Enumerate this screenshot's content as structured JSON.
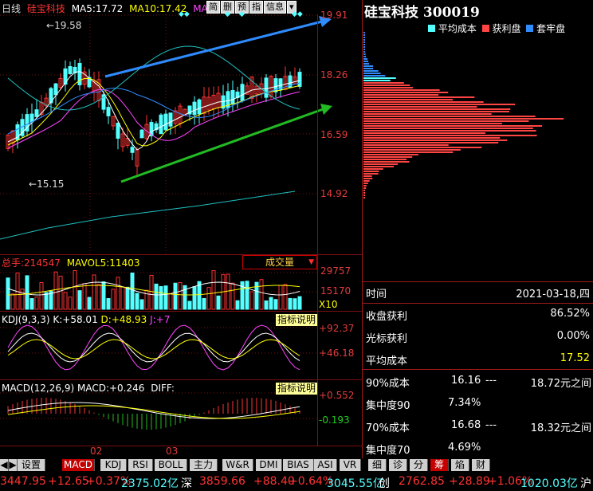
{
  "header": {
    "period": "日线",
    "stock_name": "硅宝科技",
    "ma5_label": "MA5:",
    "ma5_value": "17.72",
    "ma10_label": "MA10:",
    "ma10_value": "17.42",
    "ma20_label": "MA20:",
    "toolbar": [
      "简",
      "删",
      "预",
      "指",
      "信息"
    ],
    "dropdown_glyph": "▾"
  },
  "price_axis": {
    "labels": [
      "19.91",
      "18.26",
      "16.59",
      "14.92"
    ]
  },
  "price_annotations": {
    "high": "19.58",
    "low": "15.15"
  },
  "colors": {
    "background": "#000000",
    "up": "#ff3333",
    "down": "#54ffff",
    "grid": "#7a1010",
    "ma5": "#ffffff",
    "ma10": "#ffff00",
    "ma20": "#ff44ff",
    "channel_upper": "#2f8cff",
    "channel_lower": "#22bb22",
    "profit": "#ff4444",
    "locked": "#2f8cff",
    "avg_cost": "#54ffff"
  },
  "volume": {
    "label": "总手:",
    "value": "214547",
    "mavol_label": "MAVOL5:",
    "mavol_value": "11403",
    "dropdown": "成交量",
    "axis": [
      "29757",
      "15170",
      "X10"
    ]
  },
  "kdj": {
    "title": "KDJ(9,3,3)",
    "k_label": "K:",
    "k_value": "+58.01",
    "d_label": "D:",
    "d_value": "+48.93",
    "j_label": "J:",
    "j_value": "+7",
    "help": "指标说明",
    "axis": [
      "+92.37",
      "+46.18"
    ]
  },
  "macd": {
    "title": "MACD(12,26,9)",
    "macd_label": "MACD:",
    "macd_value": "+0.246",
    "diff_label": "DIFF:",
    "help": "指标说明",
    "axis": [
      "+0.552",
      "-0.193"
    ]
  },
  "date_axis": [
    "02",
    "03"
  ],
  "chip": {
    "title": "硅宝科技  300019",
    "legend": [
      "平均成本",
      "获利盘",
      "套牢盘"
    ],
    "info": [
      {
        "k": "时间",
        "v": "2021-03-18,四"
      },
      {
        "k": "收盘获利",
        "v": "86.52%"
      },
      {
        "k": "光标获利",
        "v": "0.00%"
      },
      {
        "k": "平均成本",
        "v": "17.52"
      }
    ],
    "range90": {
      "label": "90%成本",
      "from": "16.16",
      "sep": "---",
      "to": "18.72元之间"
    },
    "conc90": {
      "label": "集中度90",
      "value": "7.34%"
    },
    "range70": {
      "label": "70%成本",
      "from": "16.68",
      "sep": "---",
      "to": "18.32元之间"
    },
    "conc70": {
      "label": "集中度70",
      "value": "4.69%"
    }
  },
  "tabs_left": [
    "设置",
    "MACD",
    "KDJ",
    "RSI",
    "BOLL",
    "主力",
    "W&R",
    "DMI",
    "BIAS",
    "ASI",
    "VR"
  ],
  "tabs_right": [
    "细",
    "诊",
    "分",
    "筹",
    "焰",
    "财"
  ],
  "status": {
    "s1_index": "3447.95",
    "s1_chg": "+12.65",
    "s1_pct": "+0.37%",
    "s1_amt": "2375.02亿",
    "s2_name": "深",
    "s2_index": "3859.66",
    "s2_chg": "+88.40",
    "s2_pct": "+0.64%",
    "s2_amt": "3045.55亿",
    "s3_name": "创",
    "s3_index": "2762.85",
    "s3_chg": "+28.89",
    "s3_pct": "+1.06%",
    "s3_amt": "1020.03亿",
    "s4_name": "沪"
  }
}
